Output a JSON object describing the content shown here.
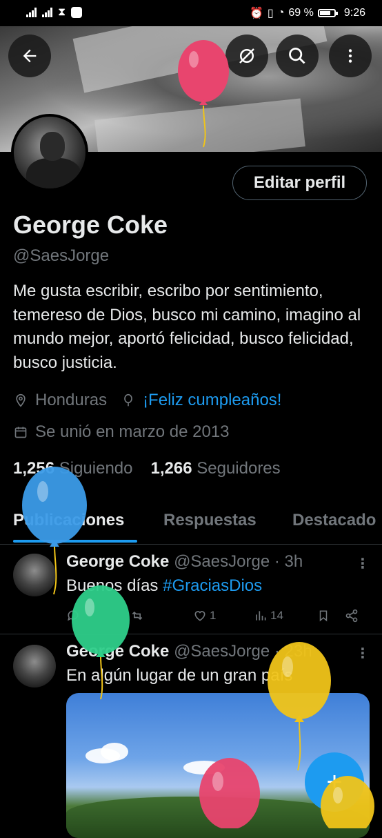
{
  "status_bar": {
    "battery": "69 %",
    "time": "9:26"
  },
  "profile": {
    "name": "George Coke",
    "handle": "@SaesJorge",
    "edit_button": "Editar perfil",
    "bio": "Me gusta escribir, escribo por sentimiento, temereso de Dios, busco mi camino, imagino al mundo mejor, aportó felicidad, busco felicidad, busco justicia.",
    "location": "Honduras",
    "birthday": "¡Feliz cumpleaños!",
    "joined": "Se unió en marzo de 2013",
    "following_count": "1,256",
    "following_label": "Siguiendo",
    "followers_count": "1,266",
    "followers_label": "Seguidores"
  },
  "tabs": [
    "Publicaciones",
    "Respuestas",
    "Destacado"
  ],
  "posts": [
    {
      "name": "George Coke",
      "meta": "@SaesJorge · 3h",
      "text_prefix": "Buenos días ",
      "hashtag": "#GraciasDios",
      "likes": "1",
      "views": "14"
    },
    {
      "name": "George Coke",
      "meta": "@SaesJorge · 23h",
      "text": "En algún lugar de un gran país"
    }
  ],
  "colors": {
    "accent": "#1d9bf0",
    "background": "#000000",
    "muted": "#71767b"
  },
  "icons": [
    "back-arrow-icon",
    "hide-icon",
    "search-icon",
    "more-vertical-icon",
    "location-icon",
    "balloon-icon",
    "calendar-icon",
    "compose-plus-icon"
  ]
}
